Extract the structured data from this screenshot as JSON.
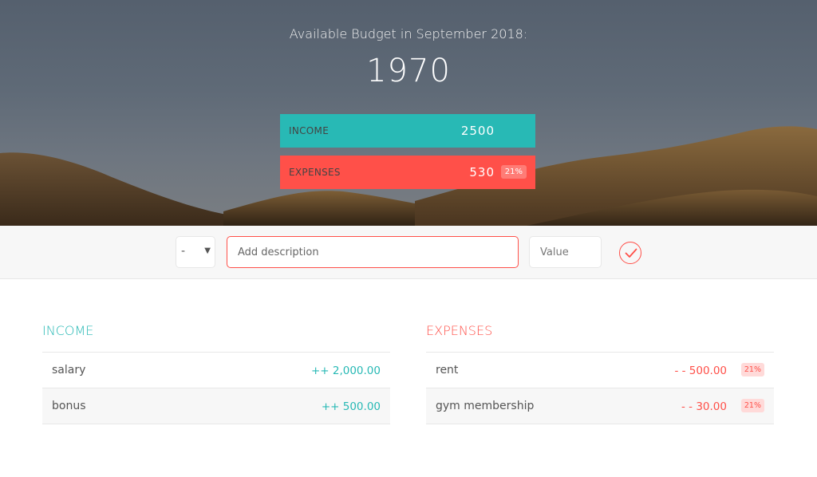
{
  "budget": {
    "title": "Available Budget in September 2018:",
    "value": "1970"
  },
  "summary": {
    "income": {
      "label": "INCOME",
      "value": "2500",
      "color": "#28b9b5"
    },
    "expenses": {
      "label": "EXPENSES",
      "value": "530",
      "percentage": "21%",
      "color": "#ff5049"
    }
  },
  "add_form": {
    "type_selected": "-",
    "type_arrow_icon": "triangle-down-icon",
    "description_placeholder": "Add description",
    "value_placeholder": "Value",
    "submit_icon": "checkmark-circle-icon"
  },
  "income": {
    "title": "INCOME",
    "items": [
      {
        "description": "salary",
        "amount": "++ 2,000.00"
      },
      {
        "description": "bonus",
        "amount": "++ 500.00"
      }
    ]
  },
  "expenses": {
    "title": "EXPENSES",
    "items": [
      {
        "description": "rent",
        "amount": "- - 500.00",
        "percentage": "21%"
      },
      {
        "description": "gym membership",
        "amount": "- - 30.00",
        "percentage": "21%"
      }
    ]
  }
}
